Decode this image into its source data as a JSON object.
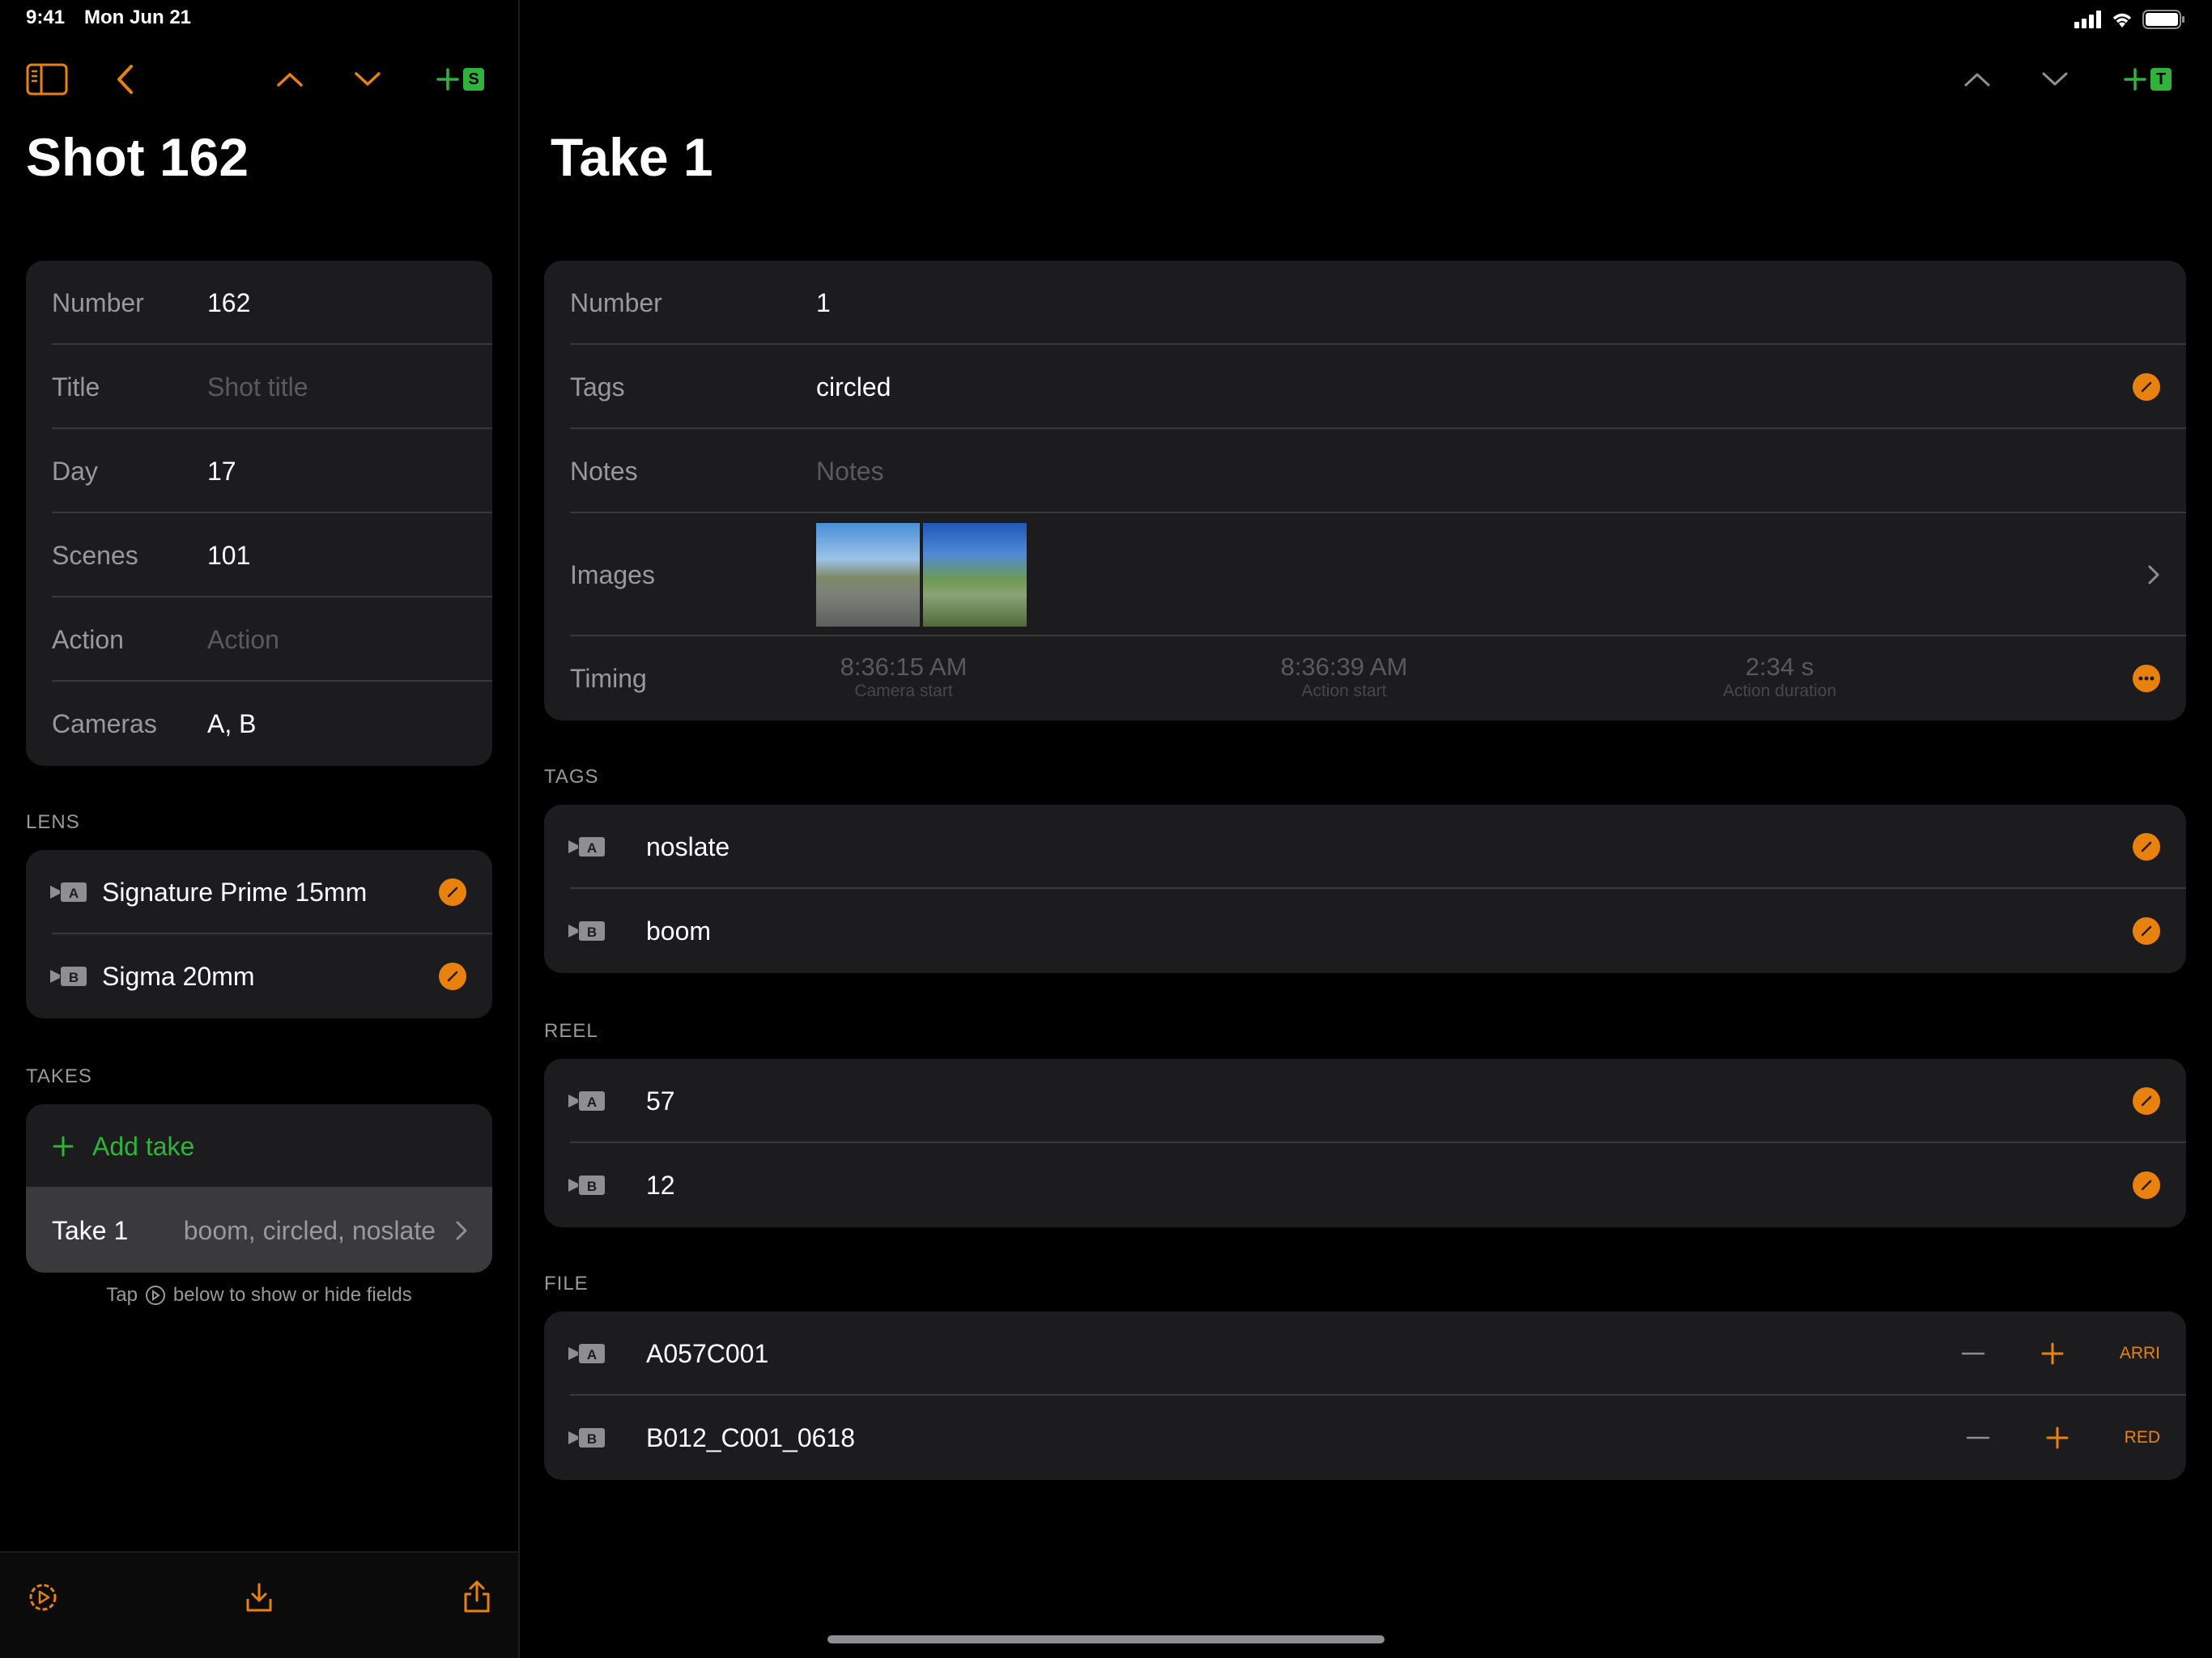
{
  "status": {
    "time": "9:41",
    "date": "Mon Jun 21"
  },
  "colors": {
    "accent": "#e8820c",
    "add": "#2fb33a",
    "card": "#1c1c1e",
    "background": "#000000"
  },
  "left": {
    "title": "Shot 162",
    "add_badge": "S",
    "fields": [
      {
        "label": "Number",
        "value": "162",
        "placeholder": ""
      },
      {
        "label": "Title",
        "value": "",
        "placeholder": "Shot title"
      },
      {
        "label": "Day",
        "value": "17",
        "placeholder": ""
      },
      {
        "label": "Scenes",
        "value": "101",
        "placeholder": ""
      },
      {
        "label": "Action",
        "value": "",
        "placeholder": "Action"
      },
      {
        "label": "Cameras",
        "value": "A, B",
        "placeholder": ""
      }
    ],
    "lens_header": "LENS",
    "lenses": [
      {
        "camera": "A",
        "name": "Signature Prime 15mm"
      },
      {
        "camera": "B",
        "name": "Sigma 20mm"
      }
    ],
    "takes_header": "TAKES",
    "add_take": "Add take",
    "takes": [
      {
        "name": "Take 1",
        "tags": "boom, circled, noslate"
      }
    ],
    "hint_before": "Tap",
    "hint_after": "below to show or hide fields"
  },
  "right": {
    "title": "Take 1",
    "add_badge": "T",
    "fields": {
      "number_label": "Number",
      "number_value": "1",
      "tags_label": "Tags",
      "tags_value": "circled",
      "notes_label": "Notes",
      "notes_placeholder": "Notes",
      "images_label": "Images",
      "timing_label": "Timing",
      "timing": [
        {
          "time": "8:36:15 AM",
          "caption": "Camera start"
        },
        {
          "time": "8:36:39 AM",
          "caption": "Action start"
        },
        {
          "time": "2:34 s",
          "caption": "Action duration"
        }
      ]
    },
    "tags_header": "TAGS",
    "tags": [
      {
        "camera": "A",
        "value": "noslate"
      },
      {
        "camera": "B",
        "value": "boom"
      }
    ],
    "reel_header": "REEL",
    "reels": [
      {
        "camera": "A",
        "value": "57"
      },
      {
        "camera": "B",
        "value": "12"
      }
    ],
    "file_header": "FILE",
    "files": [
      {
        "camera": "A",
        "value": "A057C001",
        "format": "ARRI"
      },
      {
        "camera": "B",
        "value": "B012_C001_0618",
        "format": "RED"
      }
    ]
  }
}
